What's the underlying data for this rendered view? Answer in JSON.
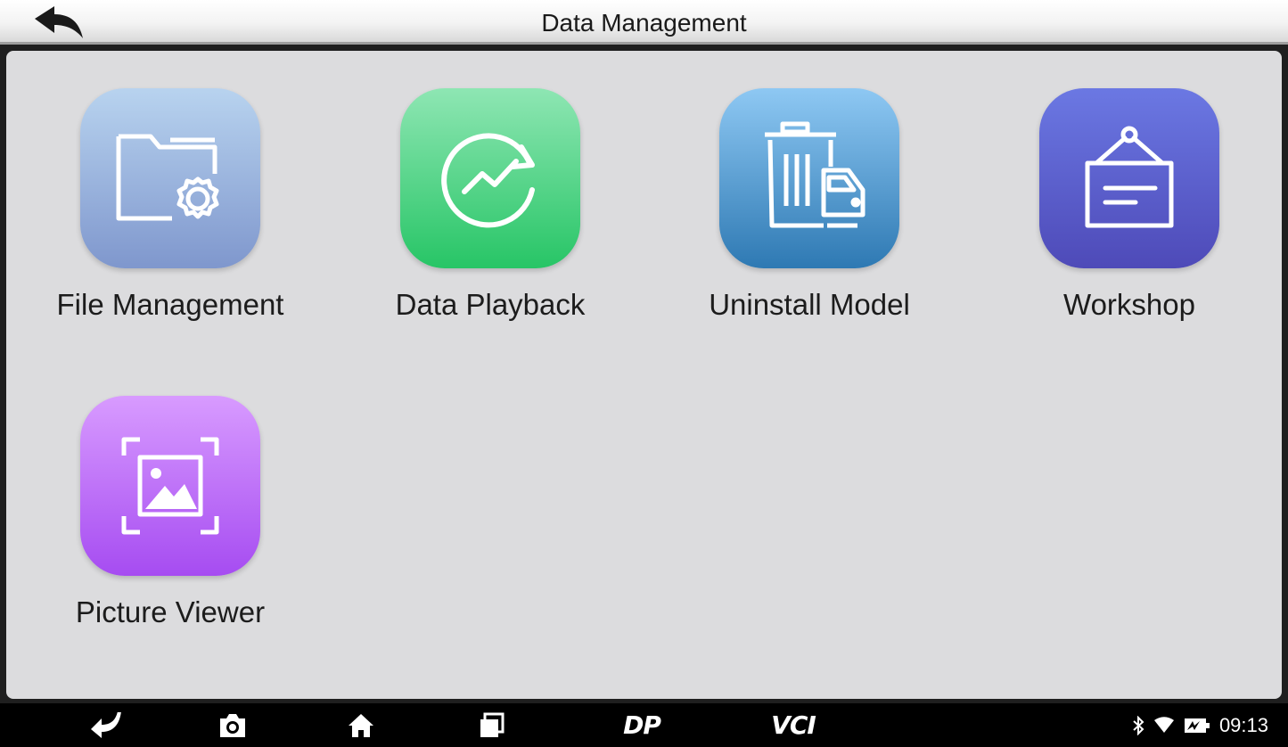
{
  "header": {
    "title": "Data Management",
    "back_icon": "back-arrow-icon"
  },
  "apps": [
    {
      "label": "File Management",
      "icon": "folder-gear-icon",
      "colors": [
        "#b8d3ef",
        "#7f97cd"
      ]
    },
    {
      "label": "Data Playback",
      "icon": "playback-chart-icon",
      "colors": [
        "#8ee6b3",
        "#27c566"
      ]
    },
    {
      "label": "Uninstall Model",
      "icon": "trash-truck-icon",
      "colors": [
        "#8ec8f3",
        "#2e79b3"
      ]
    },
    {
      "label": "Workshop",
      "icon": "hanging-sign-icon",
      "colors": [
        "#6b78e3",
        "#4e4ab8"
      ]
    },
    {
      "label": "Picture Viewer",
      "icon": "picture-frame-icon",
      "colors": [
        "#d89bff",
        "#a64cf1"
      ]
    }
  ],
  "navbar": {
    "back_icon": "return-arrow-icon",
    "camera_icon": "camera-icon",
    "home_icon": "home-icon",
    "recents_icon": "recents-icon",
    "dp_label": "DP",
    "vci_label": "VCI"
  },
  "status": {
    "bluetooth_icon": "bluetooth-icon",
    "wifi_icon": "wifi-icon",
    "battery_icon": "battery-icon",
    "time": "09:13"
  }
}
